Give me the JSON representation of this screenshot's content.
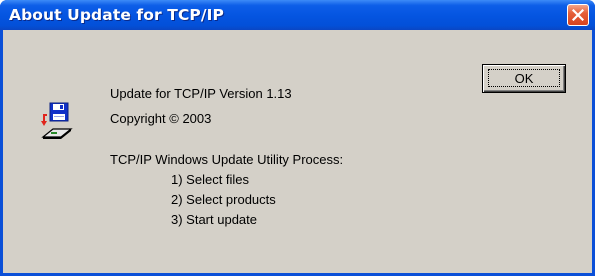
{
  "window": {
    "title": "About Update for TCP/IP"
  },
  "dialog": {
    "version_line": "Update for TCP/IP Version 1.13",
    "copyright_line": "Copyright © 2003",
    "process_heading": "TCP/IP Windows Update Utility Process:",
    "steps": [
      "1) Select files",
      "2) Select products",
      "3) Start update"
    ],
    "ok_label": "OK",
    "icon": "floppy-disk-update-icon",
    "close_icon": "close-icon"
  },
  "colors": {
    "titlebar": "#0454e0",
    "close_button": "#e5603a",
    "dialog_face": "#d4d0c8"
  }
}
